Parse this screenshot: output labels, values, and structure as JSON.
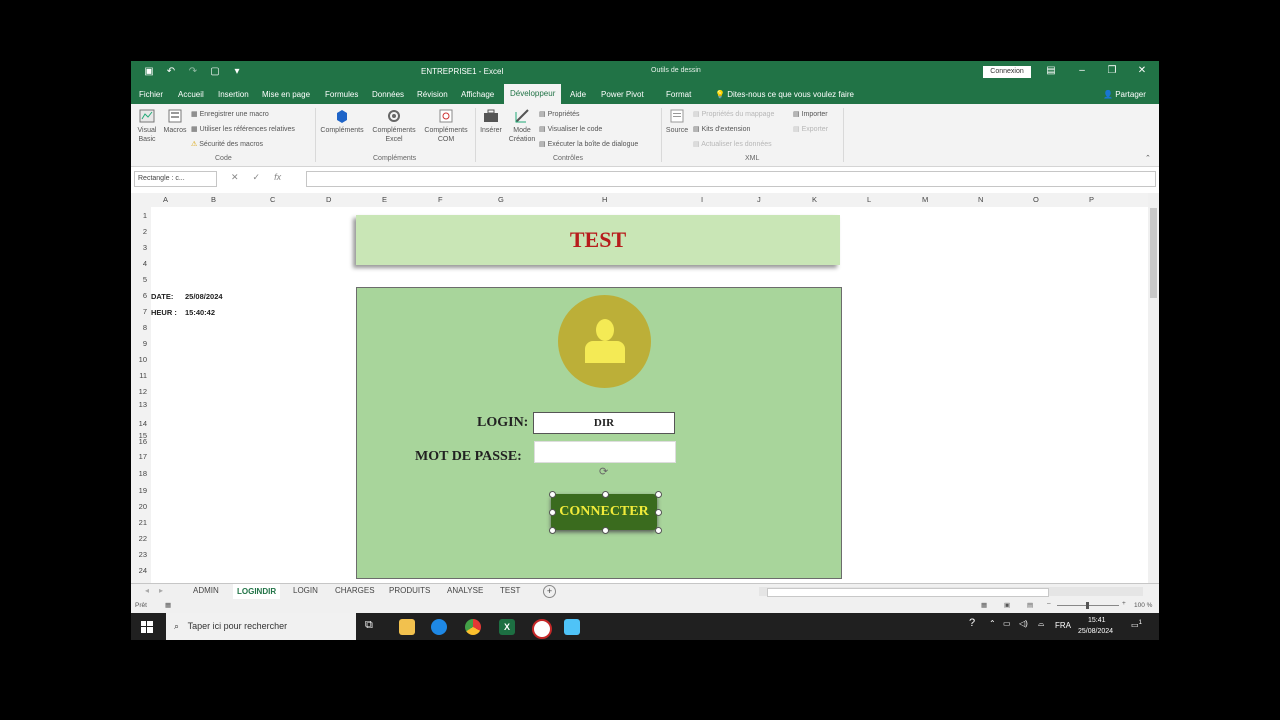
{
  "window": {
    "title": "ENTREPRISE1 - Excel",
    "context_label": "Outils de dessin",
    "signin": "Connexion",
    "qat_icons": [
      "save-icon",
      "undo-icon",
      "redo-icon",
      "customize-icon"
    ]
  },
  "ribbon_tabs": [
    "Fichier",
    "Accueil",
    "Insertion",
    "Mise en page",
    "Formules",
    "Données",
    "Révision",
    "Affichage",
    "Développeur",
    "Aide",
    "Power Pivot",
    "Format"
  ],
  "active_tab": "Développeur",
  "tell_me": "Dites-nous ce que vous voulez faire",
  "share": "Partager",
  "ribbon": {
    "code": {
      "visual_basic": "Visual Basic",
      "macros": "Macros",
      "record_macro": "Enregistrer une macro",
      "relative_refs": "Utiliser les références relatives",
      "macro_security": "Sécurité des macros",
      "group": "Code"
    },
    "addins": {
      "complements": "Compléments",
      "excel_complements": "Compléments Excel",
      "com_complements": "Compléments COM",
      "group": "Compléments"
    },
    "controls": {
      "insert": "Insérer",
      "design_mode": "Mode Création",
      "properties": "Propriétés",
      "view_code": "Visualiser le code",
      "run_dialog": "Exécuter la boîte de dialogue",
      "group": "Contrôles"
    },
    "xml": {
      "source": "Source",
      "map_props": "Propriétés du mappage",
      "expansion_packs": "Kits d'extension",
      "refresh_data": "Actualiser les données",
      "import": "Importer",
      "export": "Exporter",
      "group": "XML"
    }
  },
  "formula_bar": {
    "name_box": "Rectangle : c..."
  },
  "columns": [
    "A",
    "B",
    "C",
    "D",
    "E",
    "F",
    "G",
    "H",
    "I",
    "J",
    "K",
    "L",
    "M",
    "N",
    "O",
    "P"
  ],
  "rows": [
    "1",
    "2",
    "3",
    "4",
    "5",
    "6",
    "7",
    "8",
    "9",
    "10",
    "11",
    "12",
    "13",
    "14",
    "15",
    "16",
    "17",
    "18",
    "19",
    "20",
    "21",
    "22",
    "23",
    "24"
  ],
  "cells": {
    "date_label": "DATE:",
    "date_value": "25/08/2024",
    "time_label": "HEUR :",
    "time_value": "15:40:42"
  },
  "form": {
    "banner_title": "TEST",
    "login_label": "LOGIN:",
    "login_value": "DIR",
    "password_label": "MOT DE PASSE:",
    "password_value": "",
    "connect_button": "CONNECTER"
  },
  "sheet_tabs": [
    "ADMIN",
    "LOGINDIR",
    "LOGIN",
    "CHARGES",
    "PRODUITS",
    "ANALYSE",
    "TEST"
  ],
  "active_sheet": "LOGINDIR",
  "status": {
    "ready": "Prêt",
    "zoom": "100 %"
  },
  "taskbar": {
    "search_placeholder": "Taper ici pour rechercher",
    "language": "FRA",
    "time": "15:41",
    "date": "25/08/2024",
    "notification_count": "1"
  }
}
